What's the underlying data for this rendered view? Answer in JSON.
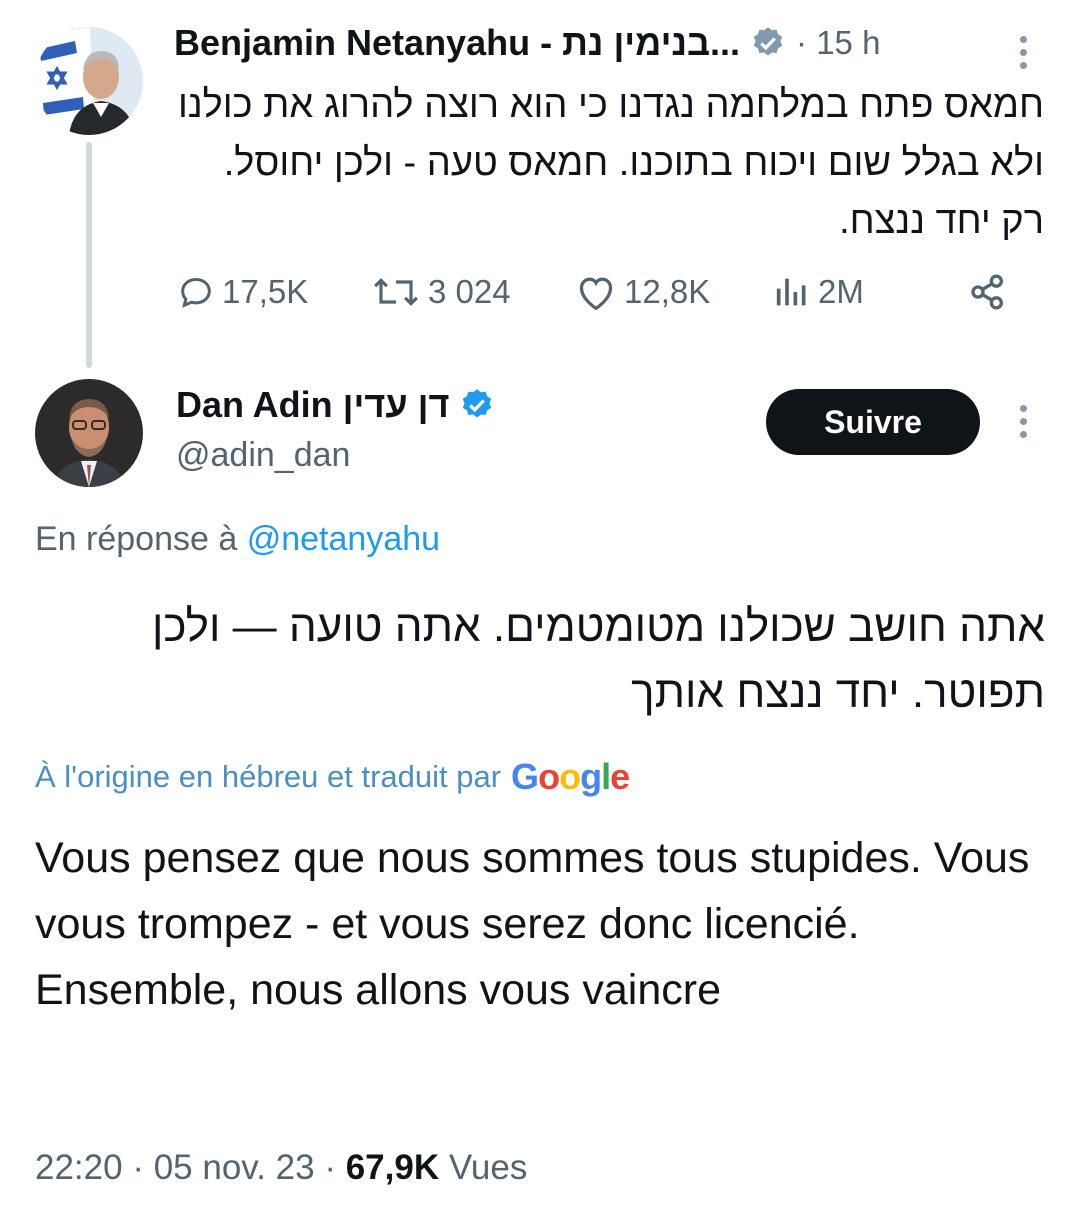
{
  "colors": {
    "text": "#0f1419",
    "muted": "#536471",
    "link": "#1d9bf0",
    "verified": "#1d9bf0",
    "translate": "#4a8fc4"
  },
  "parent_tweet": {
    "author_name": "Benjamin Netanyahu - בנימין נת...",
    "verified_icon": "verified-badge-icon",
    "time": "· 15 h",
    "text": "חמאס פתח במלחמה נגדנו כי הוא רוצה להרוג את כולנו ולא בגלל שום ויכוח בתוכנו. חמאס טעה - ולכן יחוסל. רק יחד ננצח.",
    "stats": {
      "replies": "17,5K",
      "retweets": "3 024",
      "likes": "12,8K",
      "views": "2M"
    }
  },
  "main_tweet": {
    "author_name": "Dan Adin דן עדין",
    "handle": "@adin_dan",
    "follow_label": "Suivre",
    "reply_prefix": "En réponse à",
    "reply_handle": "@netanyahu",
    "text_hebrew": "אתה חושב שכולנו מטומטמים. אתה טועה — ולכן תפוטר. יחד ננצח אותך",
    "translation_note": "À l'origine en hébreu et traduit par",
    "google_logo": "Google",
    "text_translated": "Vous pensez que nous sommes tous stupides. Vous vous trompez - et vous serez donc licencié. Ensemble, nous allons vous vaincre",
    "time": "22:20",
    "date": "05 nov. 23",
    "views_count": "67,9K",
    "views_label": "Vues"
  }
}
